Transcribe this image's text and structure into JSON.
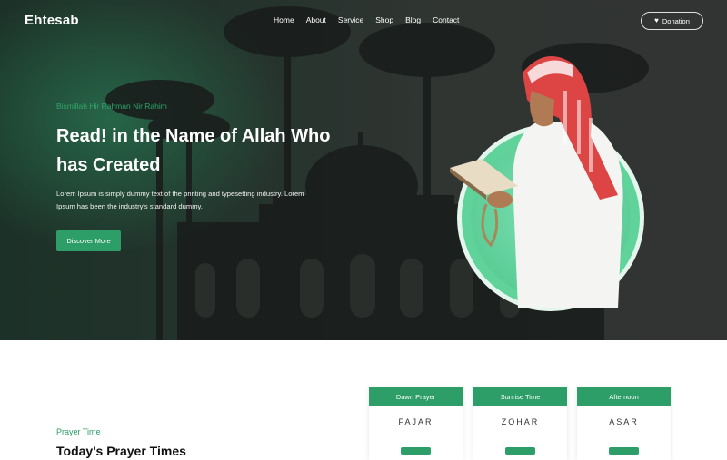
{
  "brand": {
    "logo": "Ehtesab"
  },
  "nav": {
    "items": [
      "Home",
      "About",
      "Service",
      "Shop",
      "Blog",
      "Contact"
    ],
    "donation_label": "Donation"
  },
  "hero": {
    "tagline": "Bismillah Hir Rahman Nir Rahim",
    "headline": "Read! in the Name of Allah Who has Created",
    "intro": "Lorem Ipsum is simply dummy text of the printing and typesetting industry. Lorem Ipsum has been the industry's standard dummy.",
    "button_label": "Discover More"
  },
  "prayer": {
    "label": "Prayer Time",
    "heading": "Today's Prayer Times",
    "cards": [
      {
        "title": "Dawn Prayer",
        "name": "FAJAR"
      },
      {
        "title": "Sunrise Time",
        "name": "ZOHAR"
      },
      {
        "title": "Afternoon",
        "name": "ASAR"
      }
    ]
  },
  "colors": {
    "accent": "#2e9e68",
    "hero_bg": "#2b3d34"
  },
  "icons": {
    "donation": "heart-icon"
  }
}
